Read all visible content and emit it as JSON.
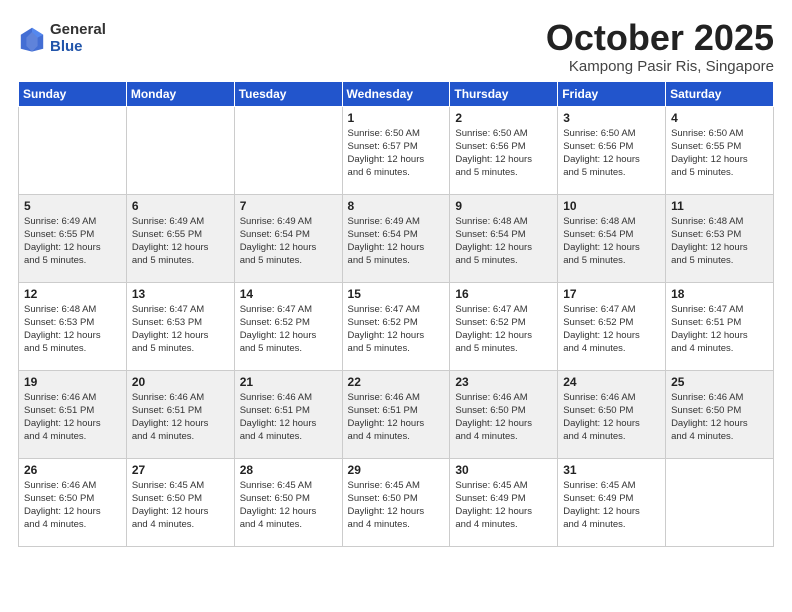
{
  "header": {
    "logo_general": "General",
    "logo_blue": "Blue",
    "month_title": "October 2025",
    "location": "Kampong Pasir Ris, Singapore"
  },
  "weekdays": [
    "Sunday",
    "Monday",
    "Tuesday",
    "Wednesday",
    "Thursday",
    "Friday",
    "Saturday"
  ],
  "weeks": [
    [
      {
        "day": "",
        "info": ""
      },
      {
        "day": "",
        "info": ""
      },
      {
        "day": "",
        "info": ""
      },
      {
        "day": "1",
        "info": "Sunrise: 6:50 AM\nSunset: 6:57 PM\nDaylight: 12 hours\nand 6 minutes."
      },
      {
        "day": "2",
        "info": "Sunrise: 6:50 AM\nSunset: 6:56 PM\nDaylight: 12 hours\nand 5 minutes."
      },
      {
        "day": "3",
        "info": "Sunrise: 6:50 AM\nSunset: 6:56 PM\nDaylight: 12 hours\nand 5 minutes."
      },
      {
        "day": "4",
        "info": "Sunrise: 6:50 AM\nSunset: 6:55 PM\nDaylight: 12 hours\nand 5 minutes."
      }
    ],
    [
      {
        "day": "5",
        "info": "Sunrise: 6:49 AM\nSunset: 6:55 PM\nDaylight: 12 hours\nand 5 minutes."
      },
      {
        "day": "6",
        "info": "Sunrise: 6:49 AM\nSunset: 6:55 PM\nDaylight: 12 hours\nand 5 minutes."
      },
      {
        "day": "7",
        "info": "Sunrise: 6:49 AM\nSunset: 6:54 PM\nDaylight: 12 hours\nand 5 minutes."
      },
      {
        "day": "8",
        "info": "Sunrise: 6:49 AM\nSunset: 6:54 PM\nDaylight: 12 hours\nand 5 minutes."
      },
      {
        "day": "9",
        "info": "Sunrise: 6:48 AM\nSunset: 6:54 PM\nDaylight: 12 hours\nand 5 minutes."
      },
      {
        "day": "10",
        "info": "Sunrise: 6:48 AM\nSunset: 6:54 PM\nDaylight: 12 hours\nand 5 minutes."
      },
      {
        "day": "11",
        "info": "Sunrise: 6:48 AM\nSunset: 6:53 PM\nDaylight: 12 hours\nand 5 minutes."
      }
    ],
    [
      {
        "day": "12",
        "info": "Sunrise: 6:48 AM\nSunset: 6:53 PM\nDaylight: 12 hours\nand 5 minutes."
      },
      {
        "day": "13",
        "info": "Sunrise: 6:47 AM\nSunset: 6:53 PM\nDaylight: 12 hours\nand 5 minutes."
      },
      {
        "day": "14",
        "info": "Sunrise: 6:47 AM\nSunset: 6:52 PM\nDaylight: 12 hours\nand 5 minutes."
      },
      {
        "day": "15",
        "info": "Sunrise: 6:47 AM\nSunset: 6:52 PM\nDaylight: 12 hours\nand 5 minutes."
      },
      {
        "day": "16",
        "info": "Sunrise: 6:47 AM\nSunset: 6:52 PM\nDaylight: 12 hours\nand 5 minutes."
      },
      {
        "day": "17",
        "info": "Sunrise: 6:47 AM\nSunset: 6:52 PM\nDaylight: 12 hours\nand 4 minutes."
      },
      {
        "day": "18",
        "info": "Sunrise: 6:47 AM\nSunset: 6:51 PM\nDaylight: 12 hours\nand 4 minutes."
      }
    ],
    [
      {
        "day": "19",
        "info": "Sunrise: 6:46 AM\nSunset: 6:51 PM\nDaylight: 12 hours\nand 4 minutes."
      },
      {
        "day": "20",
        "info": "Sunrise: 6:46 AM\nSunset: 6:51 PM\nDaylight: 12 hours\nand 4 minutes."
      },
      {
        "day": "21",
        "info": "Sunrise: 6:46 AM\nSunset: 6:51 PM\nDaylight: 12 hours\nand 4 minutes."
      },
      {
        "day": "22",
        "info": "Sunrise: 6:46 AM\nSunset: 6:51 PM\nDaylight: 12 hours\nand 4 minutes."
      },
      {
        "day": "23",
        "info": "Sunrise: 6:46 AM\nSunset: 6:50 PM\nDaylight: 12 hours\nand 4 minutes."
      },
      {
        "day": "24",
        "info": "Sunrise: 6:46 AM\nSunset: 6:50 PM\nDaylight: 12 hours\nand 4 minutes."
      },
      {
        "day": "25",
        "info": "Sunrise: 6:46 AM\nSunset: 6:50 PM\nDaylight: 12 hours\nand 4 minutes."
      }
    ],
    [
      {
        "day": "26",
        "info": "Sunrise: 6:46 AM\nSunset: 6:50 PM\nDaylight: 12 hours\nand 4 minutes."
      },
      {
        "day": "27",
        "info": "Sunrise: 6:45 AM\nSunset: 6:50 PM\nDaylight: 12 hours\nand 4 minutes."
      },
      {
        "day": "28",
        "info": "Sunrise: 6:45 AM\nSunset: 6:50 PM\nDaylight: 12 hours\nand 4 minutes."
      },
      {
        "day": "29",
        "info": "Sunrise: 6:45 AM\nSunset: 6:50 PM\nDaylight: 12 hours\nand 4 minutes."
      },
      {
        "day": "30",
        "info": "Sunrise: 6:45 AM\nSunset: 6:49 PM\nDaylight: 12 hours\nand 4 minutes."
      },
      {
        "day": "31",
        "info": "Sunrise: 6:45 AM\nSunset: 6:49 PM\nDaylight: 12 hours\nand 4 minutes."
      },
      {
        "day": "",
        "info": ""
      }
    ]
  ]
}
